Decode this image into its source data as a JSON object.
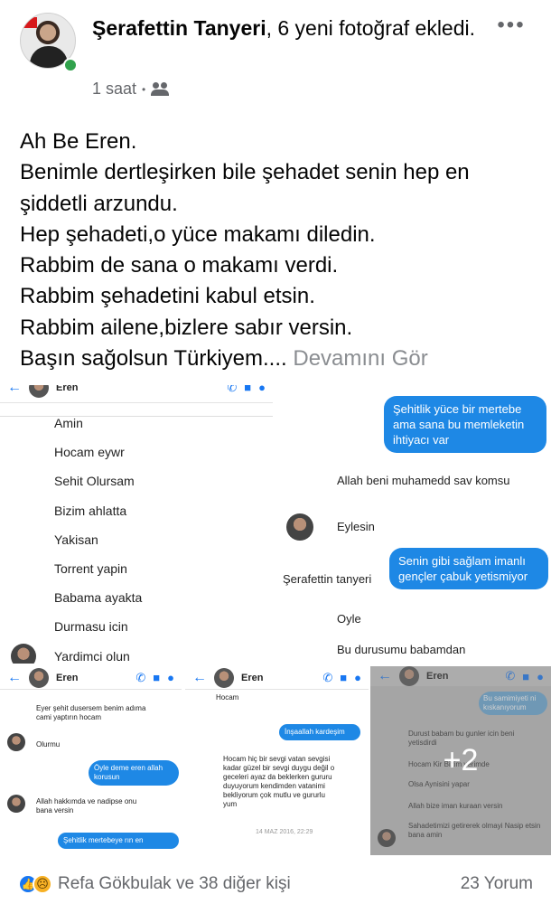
{
  "post": {
    "author": "Şerafettin Tanyeri",
    "action": ", 6 yeni fotoğraf ekledi.",
    "time": "1 saat",
    "time_separator": "•",
    "audience_icon": "friends-icon",
    "more_label": "•••",
    "text_lines": [
      "Ah Be Eren.",
      "Benimle dertleşirken bile şehadet senin hep en",
      "şiddetli arzundu.",
      "Hep şehadeti,o yüce makamı diledin.",
      "Rabbim de sana o makamı verdi.",
      "Rabbim şehadetini kabul etsin.",
      "Rabbim ailene,bizlere sabır versin.",
      "Başın sağolsun Türkiyem...."
    ],
    "see_more": "Devamını Gör"
  },
  "photos": {
    "tile_a": {
      "contact": "Eren",
      "messages": [
        "Amin",
        "Hocam eywr",
        "Sehit Olursam",
        "Bizim ahlatta",
        "Yakisan",
        "Torrent yapin",
        "Babama ayakta",
        "Durmasu icin",
        "Yardimci olun"
      ]
    },
    "tile_b": {
      "blue_1": "Şehitlik yüce bir mertebe ama sana bu memleketin ihtiyacı var",
      "msg_1": "Allah beni muhamedd sav komsu",
      "msg_2": "Eylesin",
      "blue_2": "Senin gibi sağlam imanlı gençler çabuk yetismiyor",
      "sender": "Şerafettin tanyeri",
      "msg_3": "Oyle",
      "msg_4": "Bu durusumu babamdan"
    },
    "tile_c": {
      "contact": "Eren",
      "msg_1": "Eyer şehit dusersem benim adıma cami yaptırın hocam",
      "msg_2": "Olurmu",
      "blue_1": "Öyle deme eren allah korusun",
      "msg_3": "Allah hakkımda ve nadipse onu bana versin",
      "blue_2": "Şehitlik mertebeye rın en"
    },
    "tile_d": {
      "contact": "Eren",
      "msg_0": "Hocam",
      "blue_1": "İnşaallah kardeşim",
      "msg_1": "Hocam hiç bir sevgi vatan sevgisi kadar güzel bir sevgi duygu değil o geceleri ayaz da beklerken gururu duyuyorum kendimden vatanimi bekliyorum çok mutlu ve gururlu yum",
      "timestamp": "14 MAZ 2016, 22:29"
    },
    "tile_e": {
      "contact": "Eren",
      "blue_1": "Bu samimiyeti ni kıskanıyorum",
      "msg_1": "Durust babam bu gunler icin beni yetisdirdi",
      "msg_2": "Hocam Kir Bizim yerimde",
      "msg_3": "Olsa Aynisini yapar",
      "msg_4": "Allah bize iman kuraan versin",
      "msg_5": "Sahadetimizi getirerek olmayi Nasip etsin bana amin",
      "more_count": "+2"
    }
  },
  "footer": {
    "reactions": "Refa Gökbulak ve 38 diğer kişi",
    "comments": "23 Yorum",
    "like_icon": "like-icon",
    "sad_icon": "sad-icon"
  },
  "colors": {
    "accent": "#1877f2",
    "online": "#31a24c",
    "bubble": "#1e88e5"
  }
}
